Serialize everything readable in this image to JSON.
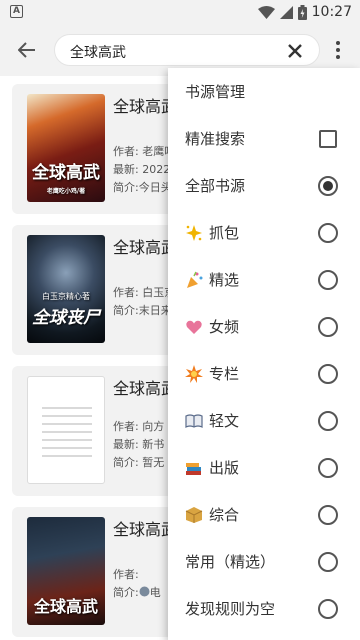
{
  "status_bar": {
    "left_badge": "A",
    "time": "10:27"
  },
  "toolbar": {
    "search_value": "全球高武"
  },
  "results": [
    {
      "title": "全球高武",
      "author": "作者: 老鹰吃小鸡",
      "latest": "最新: 2022",
      "intro": "简介:今日头",
      "cover_text": "全球高武",
      "cover_sub": "老鹰吃小鸡/著"
    },
    {
      "title": "全球高武",
      "author": "作者: 白玉京",
      "intro": "简介:末日来",
      "cover_text": "全球丧尸",
      "cover_sub": "白玉京精心著"
    },
    {
      "title": "全球高武",
      "author": "作者: 向方",
      "latest": "最新: 新书",
      "intro": "简介: 暂无"
    },
    {
      "title": "全球高武",
      "author": "作者:",
      "intro": "简介:",
      "intro_tail": "电",
      "cover_text": "全球高武"
    }
  ],
  "menu": {
    "header": "书源管理",
    "exact_search": "精准搜索",
    "all_sources": "全部书源",
    "groups": [
      {
        "label": "抓包",
        "icon": "sparkle-icon",
        "color": "#f0b400"
      },
      {
        "label": "精选",
        "icon": "party-popper-icon",
        "color": "#e85f9a"
      },
      {
        "label": "女频",
        "icon": "heart-icon",
        "color": "#e8749a"
      },
      {
        "label": "专栏",
        "icon": "burst-icon",
        "color": "#f07c1e"
      },
      {
        "label": "轻文",
        "icon": "open-book-icon",
        "color": "#5a6b8a"
      },
      {
        "label": "出版",
        "icon": "books-icon",
        "color": "#c0392b"
      },
      {
        "label": "综合",
        "icon": "package-icon",
        "color": "#d9a441"
      }
    ],
    "common": "常用（精选）",
    "discover_empty": "发现规则为空"
  },
  "colors": {
    "bar_bg": "#f2f2f2",
    "card_bg": "#f2f2f2",
    "menu_bg": "#ffffff",
    "scroll_accent": "#e0b000"
  }
}
